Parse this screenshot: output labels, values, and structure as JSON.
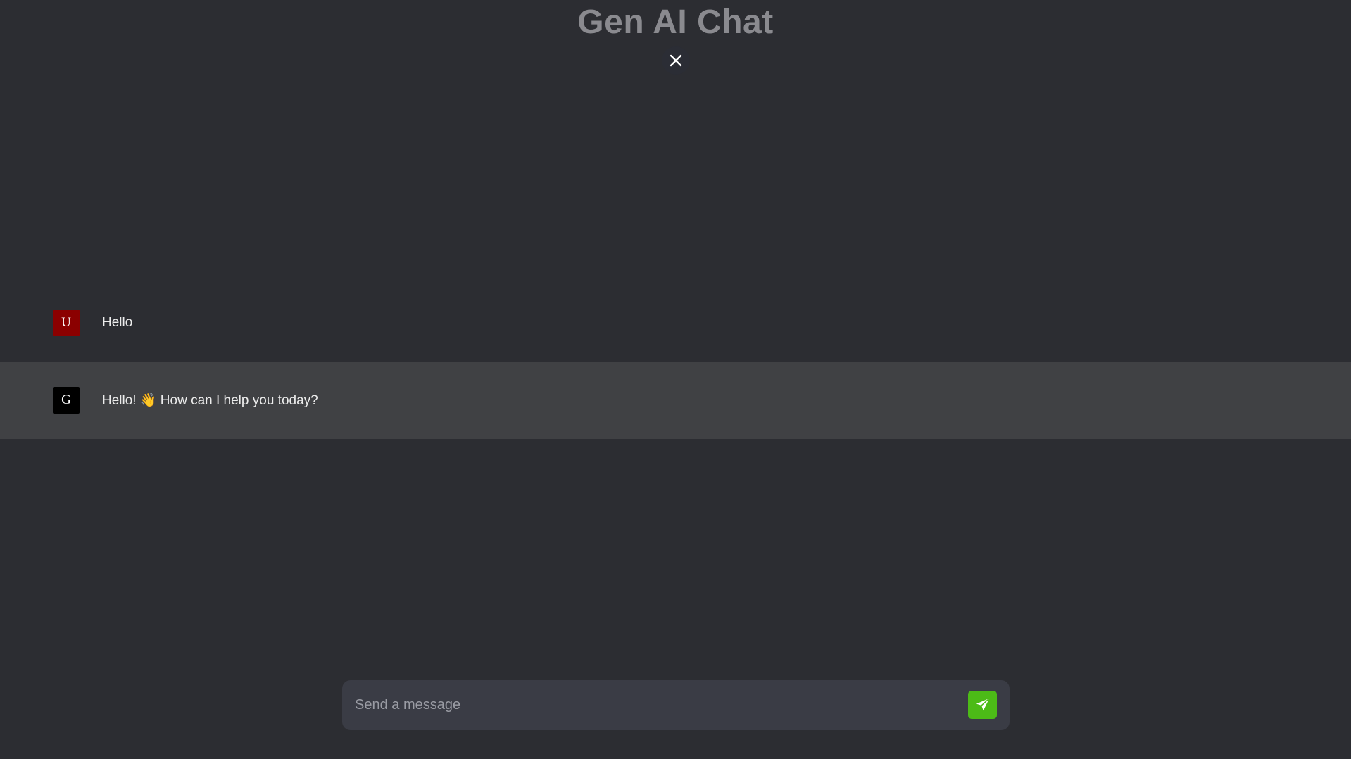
{
  "header": {
    "title": "Gen AI Chat"
  },
  "icons": {
    "close": "close-icon",
    "send": "send-icon"
  },
  "colors": {
    "background": "#2c2d32",
    "bot_row": "#404144",
    "user_avatar": "#8b0000",
    "bot_avatar": "#000000",
    "send_button": "#4cbb17"
  },
  "messages": [
    {
      "role": "user",
      "avatar_letter": "U",
      "text": "Hello"
    },
    {
      "role": "bot",
      "avatar_letter": "G",
      "text": "Hello! 👋 How can I help you today?"
    }
  ],
  "composer": {
    "placeholder": "Send a message",
    "value": ""
  }
}
